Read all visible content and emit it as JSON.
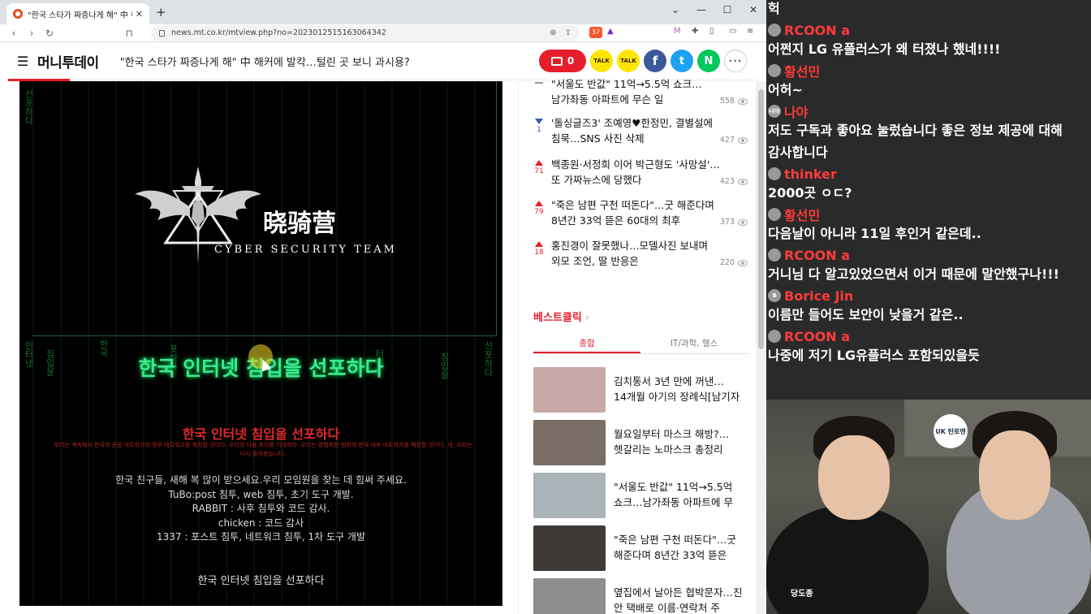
{
  "browser": {
    "tab_title": "\"한국 스타가 짜증나게 해\" 中 해커",
    "url": "news.mt.co.kr/mtview.php?no=2023012515163064342",
    "ext_badge": "37",
    "window_controls": [
      "⌄",
      "—",
      "☐",
      "✕"
    ]
  },
  "site": {
    "logo": "머니투데이",
    "headline": "\"한국 스타가 짜증나게 해\" 中 해커에 발칵…털린 곳 보니 과시용?",
    "comment_count": "0",
    "share_buttons": [
      {
        "name": "kakaotalk-icon",
        "label": "TALK"
      },
      {
        "name": "kakaotalk-share-icon",
        "label": "TALK"
      },
      {
        "name": "facebook-icon",
        "label": "f"
      },
      {
        "name": "twitter-icon",
        "label": "t"
      },
      {
        "name": "naver-icon",
        "label": "N"
      },
      {
        "name": "more-icon",
        "label": "···"
      }
    ]
  },
  "article_image": {
    "team_name": "晓骑营",
    "team_sub": "CYBER SECURITY TEAM",
    "green_banner": "한국 인터넷 침입을 선포하다",
    "red_title": "한국 인터넷 침입을 선포하다",
    "red_desc": "우리는 계속해서 한국의 공공 네트워크와 정부 네트워크를 해킹할 것이다. 우리의 다음 조치를 기대하라. 우리는 광범위한 범위의 한국 내부 네트워크를 해킹할 것이다. 네, 우리는 다시 돌아왔습니다.",
    "credits": [
      "한국 친구들, 새해 복 많이 받으세요.우리 모임원을 찾는 데 힘써 주세요.",
      "TuBo:post 침투, web 침투, 초기 도구 개발.",
      "RABBIT : 사후 침투와 코드 감사.",
      "chicken : 코드 감사",
      "1337 : 포스트 침투, 네트워크 침투, 1차 도구 개발"
    ],
    "footer": "한국 인터넷 침입을 선포하다",
    "matrix_glyphs": [
      "선포하다",
      "인터넷",
      "침입을",
      "한국",
      "포하다",
      "터넷"
    ]
  },
  "ranking": [
    {
      "trend": "flat",
      "change": "",
      "title": "\"서울도 반값\" 11억→5.5억 쇼크…남가좌동 아파트에 무슨 일",
      "views": "558"
    },
    {
      "trend": "down",
      "change": "1",
      "title": "'돌싱글즈3' 조예영♥한정민, 결별설에 침묵…SNS 사진 삭제",
      "views": "427"
    },
    {
      "trend": "up",
      "change": "71",
      "title": "백종원·서정희 이어 박근형도 '사망설'…또 가짜뉴스에 당했다",
      "views": "423"
    },
    {
      "trend": "up",
      "change": "79",
      "title": "\"죽은 남편 구천 떠돈다\"…굿 해준다며 8년간 33억 뜯은 60대의 최후",
      "views": "373"
    },
    {
      "trend": "up",
      "change": "18",
      "title": "홍진경이 잘못했나…모델사진 보내며 외모 조언, 딸 반응은",
      "views": "220"
    }
  ],
  "best_click": {
    "title": "베스트클릭",
    "chevron": "›",
    "tabs": [
      "종합",
      "IT/과학, 헬스"
    ],
    "items": [
      {
        "title": "김치통서 3년 만에 꺼낸…14개월 아기의 장례식[남기자",
        "thumb": "#c9a9a8"
      },
      {
        "title": "월요일부터 마스크 해방?…헷갈리는 노마스크 총정리",
        "thumb": "#7a6d66"
      },
      {
        "title": "\"서울도 반값\" 11억→5.5억 쇼크…남가좌동 아파트에 무",
        "thumb": "#aab3b8"
      },
      {
        "title": "\"죽은 남편 구천 떠돈다\"…굿 해준다며 8년간 33억 뜯은",
        "thumb": "#3e3a35"
      },
      {
        "title": "옆집에서 날아든 협박문자…진 안 택배로 이름·연락처 주",
        "thumb": "#8e8c8f"
      }
    ]
  },
  "chat": [
    {
      "user": "",
      "msg": "헉",
      "avatar": ""
    },
    {
      "user": "RCOON a",
      "msg": "",
      "avatar": ""
    },
    {
      "user": "",
      "msg": "어쩐지 LG 유플러스가 왜 터졌나 했네!!!!",
      "avatar": ""
    },
    {
      "user": "황선민",
      "msg": "",
      "avatar": ""
    },
    {
      "user": "",
      "msg": "어허~",
      "avatar": ""
    },
    {
      "user": "나야",
      "msg": "",
      "avatar": "나야"
    },
    {
      "user": "",
      "msg": "저도 구독과 좋아요 눌렀습니다 좋은 정보 제공에 대해",
      "avatar": ""
    },
    {
      "user": "",
      "msg": "감사합니다",
      "avatar": ""
    },
    {
      "user": "thinker",
      "msg": "",
      "avatar": ""
    },
    {
      "user": "",
      "msg": "2000곳 ㅇㄷ?",
      "avatar": ""
    },
    {
      "user": "황선민",
      "msg": "",
      "avatar": ""
    },
    {
      "user": "",
      "msg": "다음날이 아니라 11일 후인거 같은데..",
      "avatar": ""
    },
    {
      "user": "RCOON a",
      "msg": "",
      "avatar": ""
    },
    {
      "user": "",
      "msg": "거니님 다 알고있었으면서 이거 때문에 말안했구나!!!",
      "avatar": ""
    },
    {
      "user": "Borice Jin",
      "msg": "",
      "avatar": "B"
    },
    {
      "user": "",
      "msg": "이름만 들어도 보안이 낮을거 같은..",
      "avatar": ""
    },
    {
      "user": "RCOON a",
      "msg": "",
      "avatar": ""
    },
    {
      "user": "",
      "msg": "나중에 저기 LG유플러스 포함되있을듯",
      "avatar": ""
    }
  ],
  "cam": {
    "shirt_text": "당도종",
    "badge_text": "UK 탄로맨"
  }
}
